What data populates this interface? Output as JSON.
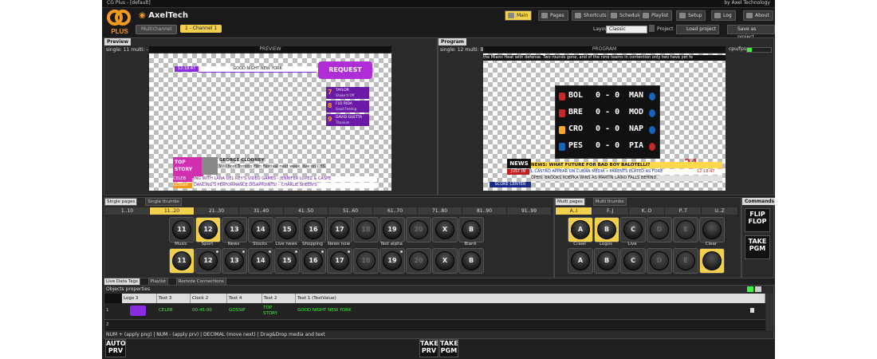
{
  "window": {
    "title": "CG Plus - [default]",
    "brand": "by Axel Technology"
  },
  "header": {
    "logo_text": "PLUS",
    "company": "AxelTech",
    "nav": [
      "Main",
      "Pages",
      "Shortcuts",
      "Scheduler",
      "Playlist",
      "Setup",
      "Log",
      "About"
    ],
    "active_nav": "Main",
    "multichannel": "Multichannel",
    "channel": "1 - Channel 1",
    "layout_label": "Layout",
    "layout_value": "Classic",
    "project_label": "Project",
    "load_project": "Load project",
    "save_project": "Save as project"
  },
  "preview": {
    "tab": "Preview",
    "info": "single: 11 multi: -",
    "title": "PREVIEW",
    "clock": "12:18:47",
    "headline": "GOOD NIGHT NEW YORK",
    "request_brand": "REQUEST",
    "chart": [
      {
        "n": "7",
        "a": "TAYLOR",
        "b": "Shake It Off"
      },
      {
        "n": "8",
        "a": "FLO RIDA",
        "b": "Good Feeling"
      },
      {
        "n": "9",
        "a": "DAVID GUETTA",
        "b": "Titanium"
      }
    ],
    "topstory": "TOP STORY",
    "story_title": "GEORGE CLOONEY:",
    "story_text": "Will host Toronto Film Festival next week, live on CBS.",
    "celeb": "CELEB",
    "ticker1": "ING WITH LANA DEL REY'S VIDEO GAMES  -  JENNIFER LOPEZ & CASPE",
    "gossip": "GOSSIP",
    "ticker2": "DANCING'S PERFORMANCE DISAPPOINTS!  -  CHARLIE SHEEN'S"
  },
  "program": {
    "tab": "Program",
    "info": "single: 12 multi: B-A",
    "title": "PROGRAM",
    "cpu": "cpu/fps:",
    "crawl": "the Miami Heat with defense.   Two rounds gone, and of the nine teams in contention only two have yet fe",
    "scores": [
      {
        "h": "BOL",
        "s": "0 - 0",
        "a": "MAN"
      },
      {
        "h": "BRE",
        "s": "0 - 0",
        "a": "MOD"
      },
      {
        "h": "CRO",
        "s": "0 - 0",
        "a": "NAP"
      },
      {
        "h": "PES",
        "s": "0 - 0",
        "a": "PIA"
      }
    ],
    "number": "24",
    "news": "NEWS",
    "justin": "JUST IN",
    "headline": "NEWS: WHAT FUTURE FOR BAD BOY BALOTELLI?",
    "line2": "L CASTRO APPEAR ON CUBAN MEDIA   •   PARENTS ELATED AS FORE",
    "time": "12:18:47",
    "line3": "OPEN: BROOKS KOEPKA WINS AS MARTIN LAIRD FALLS BEHIND.",
    "scorecenter": "SCORE CENTER"
  },
  "single": {
    "tabs": [
      "Single pages",
      "Single thumbs"
    ],
    "ranges": [
      "1..10",
      "11..20",
      "21..30",
      "31..40",
      "41..50",
      "51..60",
      "61..70",
      "71..80",
      "81..90",
      "91..99"
    ],
    "active_range": "11..20",
    "row1": [
      {
        "k": "11",
        "l": "Music"
      },
      {
        "k": "12",
        "l": "Sport"
      },
      {
        "k": "13",
        "l": "News"
      },
      {
        "k": "14",
        "l": "Stocks"
      },
      {
        "k": "15",
        "l": "Live news"
      },
      {
        "k": "16",
        "l": "Shopping"
      },
      {
        "k": "17",
        "l": "News now"
      },
      {
        "k": "18",
        "l": ""
      },
      {
        "k": "19",
        "l": "Test alpha"
      },
      {
        "k": "20",
        "l": ""
      },
      {
        "k": "X",
        "l": ""
      },
      {
        "k": "B",
        "l": "Blank"
      }
    ],
    "row2": [
      "11",
      "12",
      "13",
      "14",
      "15",
      "16",
      "17",
      "18",
      "19",
      "20",
      "X",
      "B"
    ]
  },
  "multi": {
    "tabs": [
      "Multi pages",
      "Multi thumbs"
    ],
    "ranges": [
      "A..I",
      "F..J",
      "K..O",
      "P..T",
      "U..Z"
    ],
    "active_range": "A..I",
    "row1": [
      {
        "k": "A",
        "l": "Crawl"
      },
      {
        "k": "B",
        "l": "Logos"
      },
      {
        "k": "C",
        "l": "Live"
      },
      {
        "k": "D",
        "l": ""
      },
      {
        "k": "E",
        "l": ""
      },
      {
        "k": "",
        "l": "Clear"
      }
    ],
    "row2": [
      "A",
      "B",
      "C",
      "D",
      "E",
      ""
    ]
  },
  "commands": {
    "title": "Commands",
    "flipflop": "FLIP FLOP",
    "takepgm": "TAKE PGM"
  },
  "live": {
    "tabs": [
      "Live Data Tags",
      "Playlist",
      "Remote Connections"
    ],
    "props": "Objects properties",
    "columns": [
      "Logo 3 (FileNa...",
      "Text 3 (TextVal...",
      "Clock 2 (StartTi...",
      "Text 4 (TextVal...",
      "Text 2 (TextVal...",
      "Text 1 (TextValue)"
    ],
    "row": {
      "idx": "1",
      "c2": "CELEB",
      "c3": "00:45:00",
      "c4": "GOSSIP",
      "c5": "TOP STORY",
      "c6": "GOOD NIGHT NEW YORK"
    },
    "row2idx": "2",
    "hint": "NUM + (apply png) | NUM - (apply prv) | DECIMAL (move next) | Drag&Drop media and text"
  },
  "bottom": {
    "autoprv": "AUTO PRV",
    "takeprv": "TAKE PRV",
    "takepgm": "TAKE PGM"
  }
}
